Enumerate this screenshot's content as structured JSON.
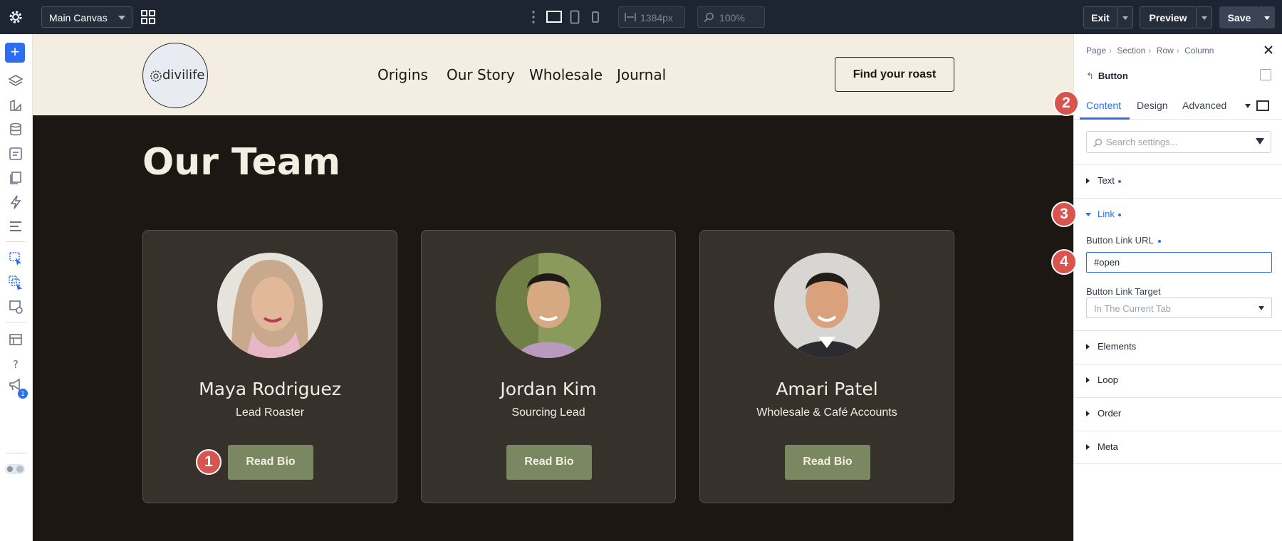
{
  "topbar": {
    "canvas_select": "Main Canvas",
    "width_value": "1384px",
    "zoom_value": "100%",
    "exit_label": "Exit",
    "preview_label": "Preview",
    "save_label": "Save"
  },
  "sidebar": {
    "notification_count": "1"
  },
  "site": {
    "logo_text": "divilife",
    "nav": [
      "Origins",
      "Our Story",
      "Wholesale",
      "Journal"
    ],
    "cta_label": "Find your roast",
    "section_title": "Our Team",
    "team": [
      {
        "name": "Maya Rodriguez",
        "role": "Lead Roaster",
        "button": "Read Bio",
        "photo_color": "#c9a98c"
      },
      {
        "name": "Jordan Kim",
        "role": "Sourcing Lead",
        "button": "Read Bio",
        "photo_color": "#8a9a5b"
      },
      {
        "name": "Amari Patel",
        "role": "Wholesale & Café Accounts",
        "button": "Read Bio",
        "photo_color": "#d8d6d2"
      }
    ]
  },
  "markers": [
    "1",
    "2",
    "3",
    "4"
  ],
  "panel": {
    "breadcrumbs": [
      "Page",
      "Section",
      "Row",
      "Column"
    ],
    "title": "Button",
    "tabs": [
      "Content",
      "Design",
      "Advanced"
    ],
    "search_placeholder": "Search settings...",
    "groups": {
      "text": "Text",
      "link": "Link",
      "elements": "Elements",
      "loop": "Loop",
      "order": "Order",
      "meta": "Meta"
    },
    "link_url_label": "Button Link URL",
    "link_url_value": "#open",
    "link_target_label": "Button Link Target",
    "link_target_value": "In The Current Tab"
  },
  "colors": {
    "accent": "#2b6ff0",
    "marker": "#d9534f",
    "canvas_bg": "#1c1713",
    "header_bg": "#f3ede2",
    "card_bg": "#37312c",
    "button_bg": "#7a8862"
  }
}
